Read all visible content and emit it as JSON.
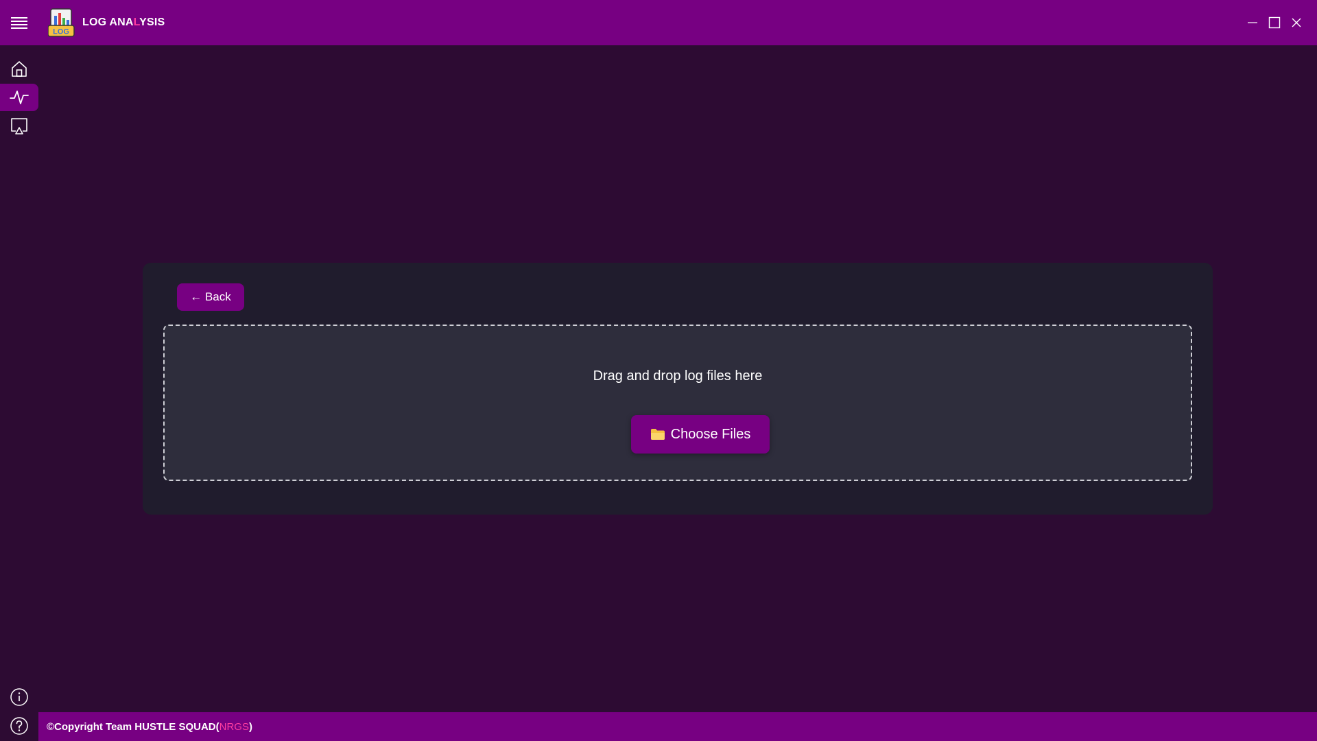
{
  "app": {
    "title_part1": "LOG ANA",
    "title_accent": "L",
    "title_part2": "YSIS",
    "logo_text": "LOG"
  },
  "sidebar": {
    "items": [
      {
        "icon": "home-icon",
        "active": false
      },
      {
        "icon": "activity-icon",
        "active": true
      },
      {
        "icon": "cast-icon",
        "active": false
      }
    ],
    "bottom_items": [
      {
        "icon": "info-icon"
      },
      {
        "icon": "help-icon"
      }
    ]
  },
  "main": {
    "back_label": "← Back",
    "dropzone_text": "Drag and drop log files here",
    "choose_files_label": "Choose Files"
  },
  "footer": {
    "copyright": "©Copyright Team HUSTLE SQUAD(",
    "team": "NRGS",
    "closing": ")"
  },
  "colors": {
    "accent": "#770082",
    "background": "#2d0b33",
    "card": "#201c2d",
    "dropzone": "#2e2d3c",
    "highlight": "#ff3da0",
    "folder": "#f6c142"
  }
}
